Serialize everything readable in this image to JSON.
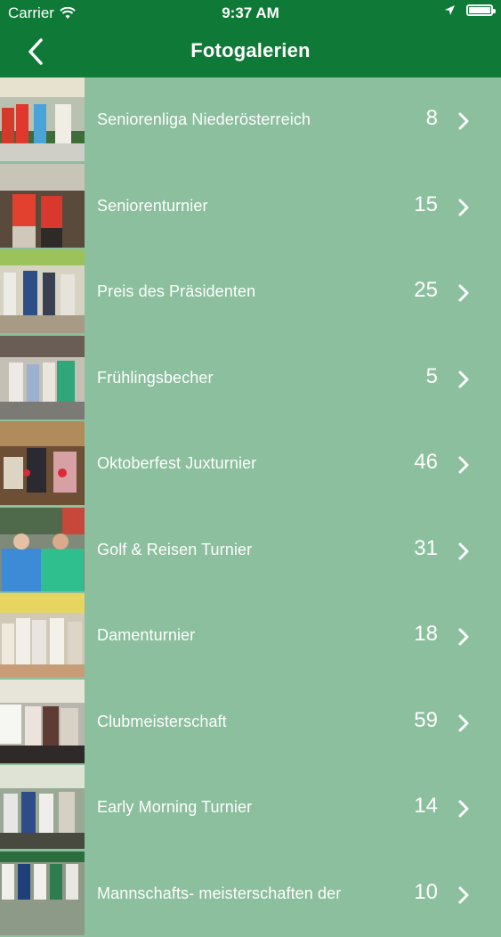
{
  "status": {
    "carrier": "Carrier",
    "time": "9:37 AM",
    "wifi_icon": "wifi-icon",
    "location_icon": "location-arrow-icon",
    "battery_icon": "battery-icon"
  },
  "nav": {
    "title": "Fotogalerien",
    "back_icon": "chevron-left-icon"
  },
  "colors": {
    "bar": "#0f7a37",
    "background": "#8bbf9e",
    "text": "#ffffff"
  },
  "galleries": [
    {
      "label": "Seniorenliga Niederösterreich",
      "count": "8"
    },
    {
      "label": "Seniorenturnier",
      "count": "15"
    },
    {
      "label": "Preis des Präsidenten",
      "count": "25"
    },
    {
      "label": "Frühlingsbecher",
      "count": "5"
    },
    {
      "label": "Oktoberfest Juxturnier",
      "count": "46"
    },
    {
      "label": "Golf & Reisen Turnier",
      "count": "31"
    },
    {
      "label": "Damenturnier",
      "count": "18"
    },
    {
      "label": "Clubmeisterschaft",
      "count": "59"
    },
    {
      "label": "Early Morning Turnier",
      "count": "14"
    },
    {
      "label": "Mannschafts- meisterschaften der",
      "count": "10"
    }
  ]
}
